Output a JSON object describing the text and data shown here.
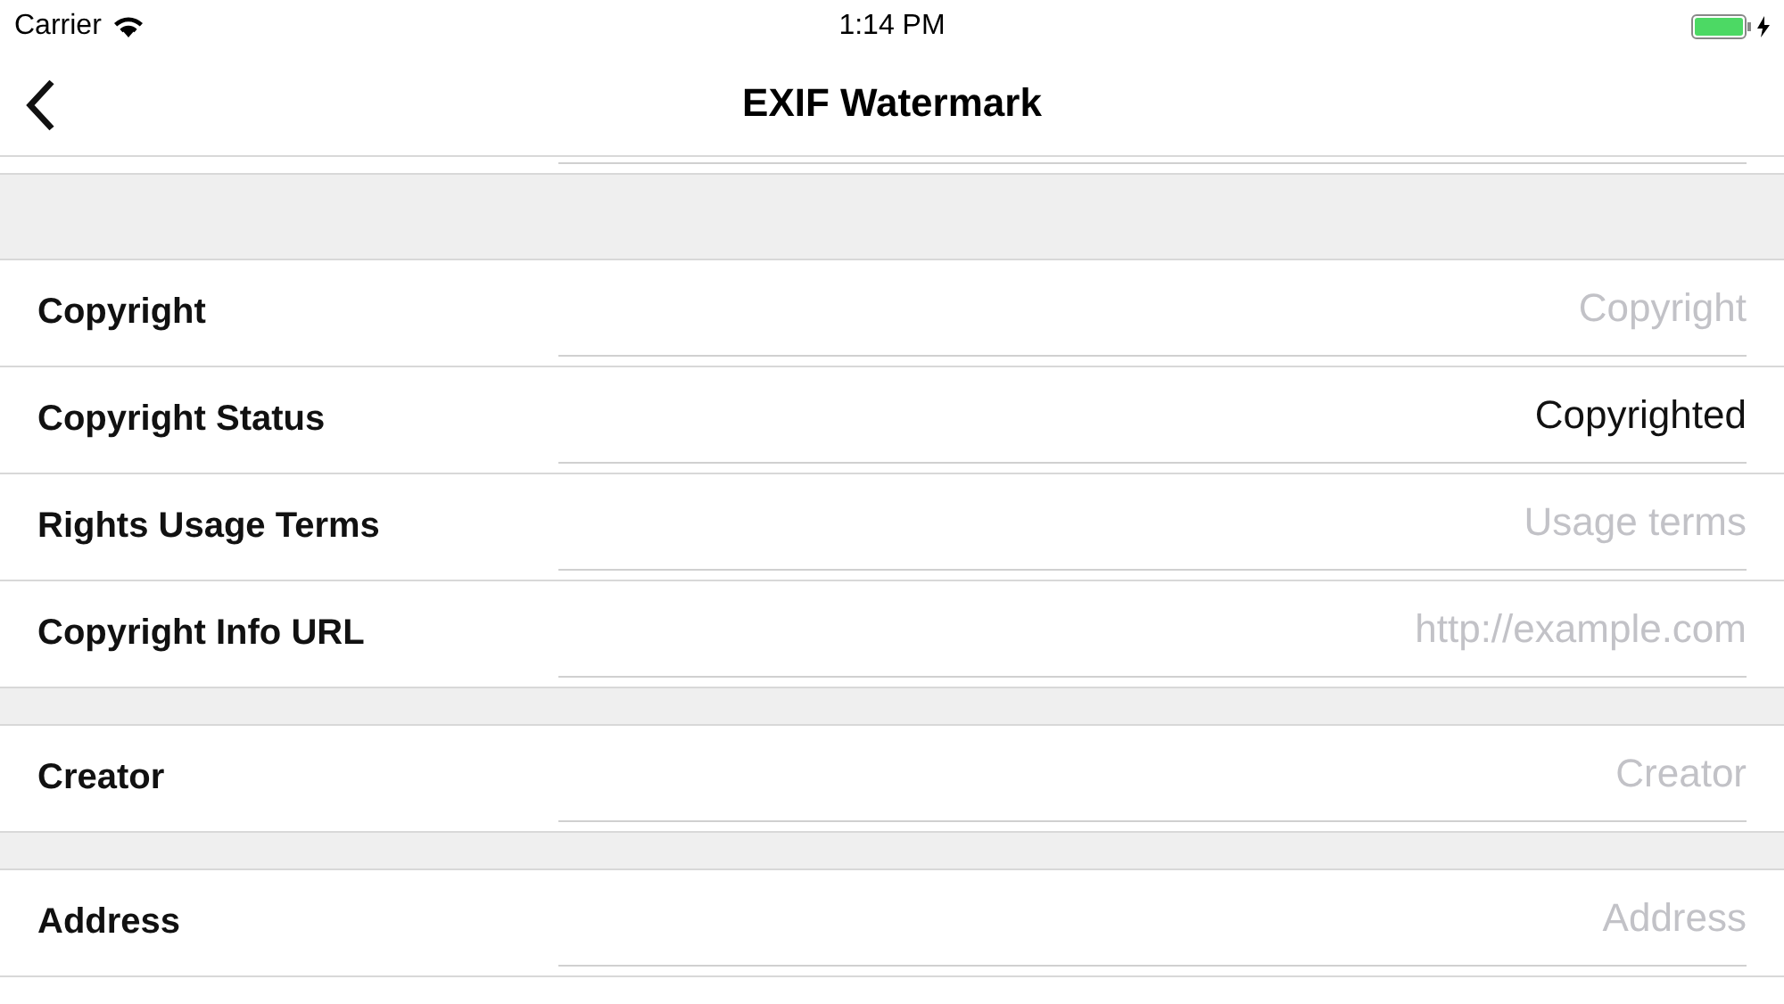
{
  "status_bar": {
    "carrier": "Carrier",
    "time": "1:14 PM",
    "charging": true
  },
  "nav_bar": {
    "title": "EXIF Watermark"
  },
  "sections": [
    {
      "rows": [
        {
          "label": "Copyright",
          "placeholder": "Copyright"
        },
        {
          "label": "Copyright Status",
          "value": "Copyrighted"
        },
        {
          "label": "Rights Usage Terms",
          "placeholder": "Usage terms"
        },
        {
          "label": "Copyright Info URL",
          "placeholder": "http://example.com"
        }
      ]
    },
    {
      "rows": [
        {
          "label": "Creator",
          "placeholder": "Creator"
        }
      ]
    },
    {
      "rows": [
        {
          "label": "Address",
          "placeholder": "Address"
        }
      ]
    }
  ]
}
